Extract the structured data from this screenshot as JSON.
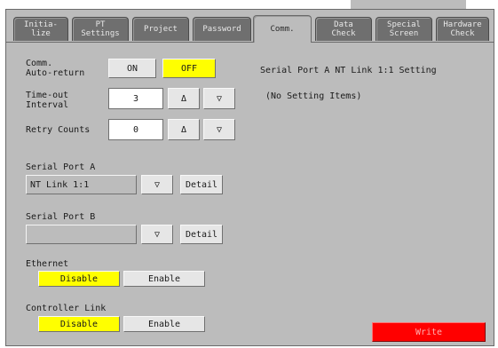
{
  "tabs": [
    {
      "label": "Initia-\nlize"
    },
    {
      "label": "PT\nSettings"
    },
    {
      "label": "Project"
    },
    {
      "label": "Password"
    },
    {
      "label": "Comm."
    },
    {
      "label": "Data\nCheck"
    },
    {
      "label": "Special\nScreen"
    },
    {
      "label": "Hardware\nCheck"
    }
  ],
  "comm_auto_return": {
    "label": "Comm.\nAuto-return",
    "on_label": "ON",
    "off_label": "OFF"
  },
  "timeout": {
    "label": "Time-out\nInterval",
    "value": "3",
    "up_icon": "Δ",
    "down_icon": "▽"
  },
  "retry": {
    "label": "Retry Counts",
    "value": "0",
    "up_icon": "Δ",
    "down_icon": "▽"
  },
  "serial_a": {
    "label": "Serial Port A",
    "value": "NT Link 1:1",
    "dropdown_icon": "▽",
    "detail_label": "Detail"
  },
  "serial_b": {
    "label": "Serial Port B",
    "value": "",
    "dropdown_icon": "▽",
    "detail_label": "Detail"
  },
  "ethernet": {
    "label": "Ethernet",
    "disable_label": "Disable",
    "enable_label": "Enable"
  },
  "controller_link": {
    "label": "Controller Link",
    "disable_label": "Disable",
    "enable_label": "Enable"
  },
  "right_panel": {
    "heading": "Serial Port A NT Link 1:1 Setting",
    "note": "(No Setting Items)"
  },
  "write_button": {
    "label": "Write"
  },
  "colors": {
    "background": "#bcbcbc",
    "selected": "#ffff00",
    "write": "#ff0000",
    "tab_inactive": "#6f6f6f"
  }
}
